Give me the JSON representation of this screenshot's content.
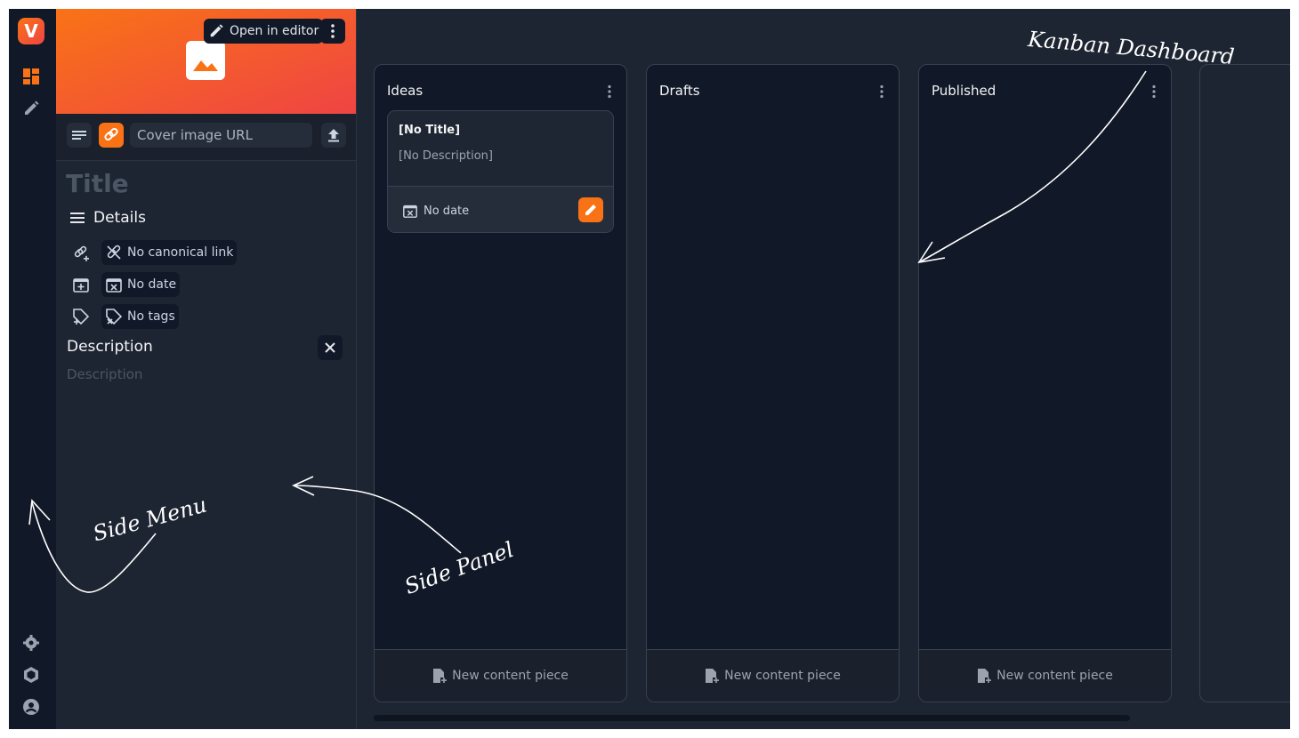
{
  "app": {
    "logo_letter": "V",
    "accent": "#f97316"
  },
  "rail": {
    "top_items": [
      "dashboard-icon",
      "pencil-icon"
    ],
    "bottom_items": [
      "settings-icon",
      "extensions-icon",
      "profile-icon"
    ]
  },
  "side_panel": {
    "open_in_editor": "Open in editor",
    "cover_image_placeholder": "Cover image URL",
    "title_placeholder": "Title",
    "details_label": "Details",
    "canonical_link": "No canonical link",
    "date": "No date",
    "tags": "No tags",
    "description_label": "Description",
    "description_placeholder": "Description"
  },
  "kanban": {
    "columns": [
      {
        "title": "Ideas",
        "footer": "New content piece"
      },
      {
        "title": "Drafts",
        "footer": "New content piece"
      },
      {
        "title": "Published",
        "footer": "New content piece"
      }
    ],
    "cards": [
      {
        "title": "[No Title]",
        "description": "[No Description]",
        "date": "No date"
      }
    ]
  },
  "annotations": {
    "kanban": "Kanban Dashboard",
    "side_menu": "Side Menu",
    "side_panel": "Side Panel"
  }
}
